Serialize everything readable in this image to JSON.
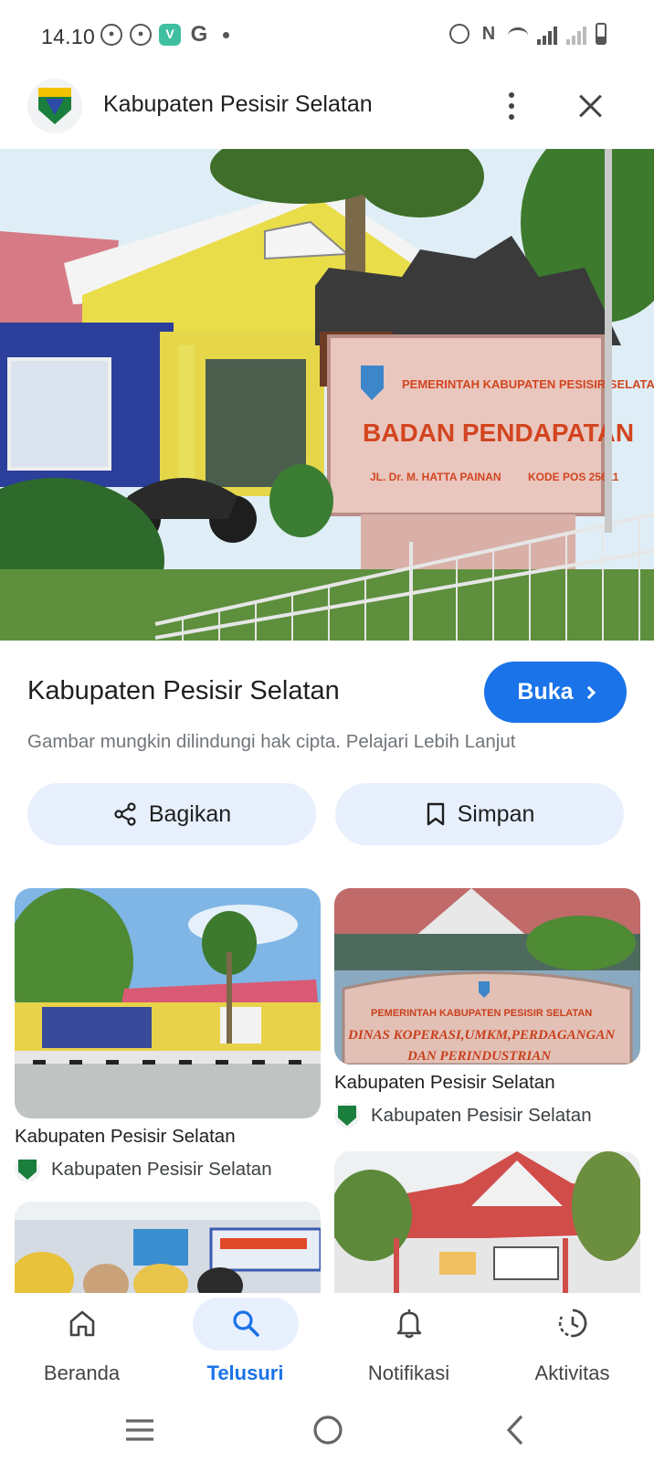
{
  "status_bar": {
    "time": "14.10",
    "left_icons": [
      "whatsapp-icon",
      "whatsapp-icon",
      "vpn-app-icon",
      "google-icon",
      "notification-dot"
    ],
    "right_icons": [
      "alarm-icon",
      "nfc-icon",
      "wifi-icon",
      "signal-icon",
      "signal-icon",
      "battery-icon"
    ]
  },
  "header": {
    "title": "Kabupaten Pesisir Selatan"
  },
  "hero": {
    "sign_line1": "PEMERINTAH KABUPATEN PESISIR SELATAN",
    "sign_line2": "BADAN PENDAPATAN",
    "sign_line3": "JL. Dr. M. HATTA PAINAN",
    "sign_line4": "KODE POS 25611"
  },
  "info": {
    "title": "Kabupaten Pesisir Selatan",
    "open_label": "Buka",
    "copyright_text": "Gambar mungkin dilindungi hak cipta. Pelajari Lebih Lanjut"
  },
  "actions": {
    "share_label": "Bagikan",
    "save_label": "Simpan"
  },
  "results": [
    {
      "title": "Kabupaten Pesisir Selatan",
      "source": "Kabupaten Pesisir Selatan"
    },
    {
      "title": "Kabupaten Pesisir Selatan",
      "source": "Kabupaten Pesisir Selatan"
    },
    {
      "sign_line1": "PEMERINTAH KABUPATEN PESISIR SELATAN",
      "sign_line2": "DINAS KOPERASI,UMKM,PERDAGANGAN",
      "sign_line3": "DAN PERINDUSTRIAN"
    }
  ],
  "bottom_nav": {
    "items": [
      {
        "label": "Beranda",
        "icon": "home-icon",
        "active": false
      },
      {
        "label": "Telusuri",
        "icon": "search-icon",
        "active": true
      },
      {
        "label": "Notifikasi",
        "icon": "bell-icon",
        "active": false
      },
      {
        "label": "Aktivitas",
        "icon": "history-icon",
        "active": false
      }
    ]
  },
  "colors": {
    "accent": "#1a73e8",
    "pill_bg": "#e8f0fe",
    "text_secondary": "#70757a"
  }
}
